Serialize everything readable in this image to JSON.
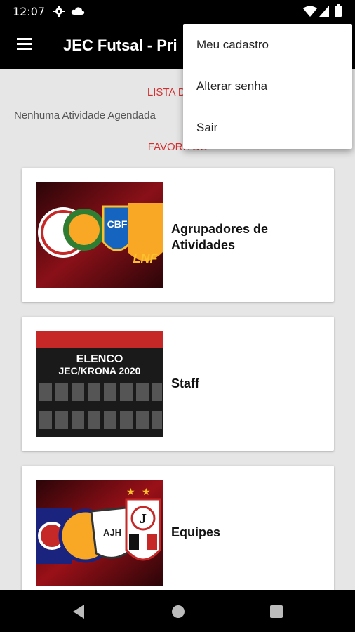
{
  "status_bar": {
    "time": "12:07",
    "icons": [
      "gear-icon",
      "cloud-icon",
      "wifi-icon",
      "signal-icon",
      "battery-icon"
    ]
  },
  "app_bar": {
    "title": "JEC Futsal - Pri",
    "menu_icon": "hamburger-icon"
  },
  "main": {
    "activities_title": "LISTA DE AT",
    "empty_message": "Nenhuma Atividade Agendada",
    "favorites_title": "FAVORITOS",
    "cards": [
      {
        "label_line1": "Agrupadores de",
        "label_line2": "Atividades",
        "thumb_text": "LNF",
        "thumb_badge": "CBF"
      },
      {
        "label_line1": "Staff",
        "thumb_title_1": "ELENCO",
        "thumb_title_2": "JEC/KRONA 2020"
      },
      {
        "label_line1": "Equipes",
        "thumb_badge_1": "AJH",
        "thumb_badge_2": "J"
      }
    ]
  },
  "overflow_menu": {
    "items": [
      "Meu cadastro",
      "Alterar senha",
      "Sair"
    ]
  },
  "nav_bar": {
    "icons": [
      "back-icon",
      "home-icon",
      "recents-icon"
    ]
  },
  "colors": {
    "accent": "#d32f2f",
    "appbar": "#000000",
    "background": "#e6e6e6"
  }
}
